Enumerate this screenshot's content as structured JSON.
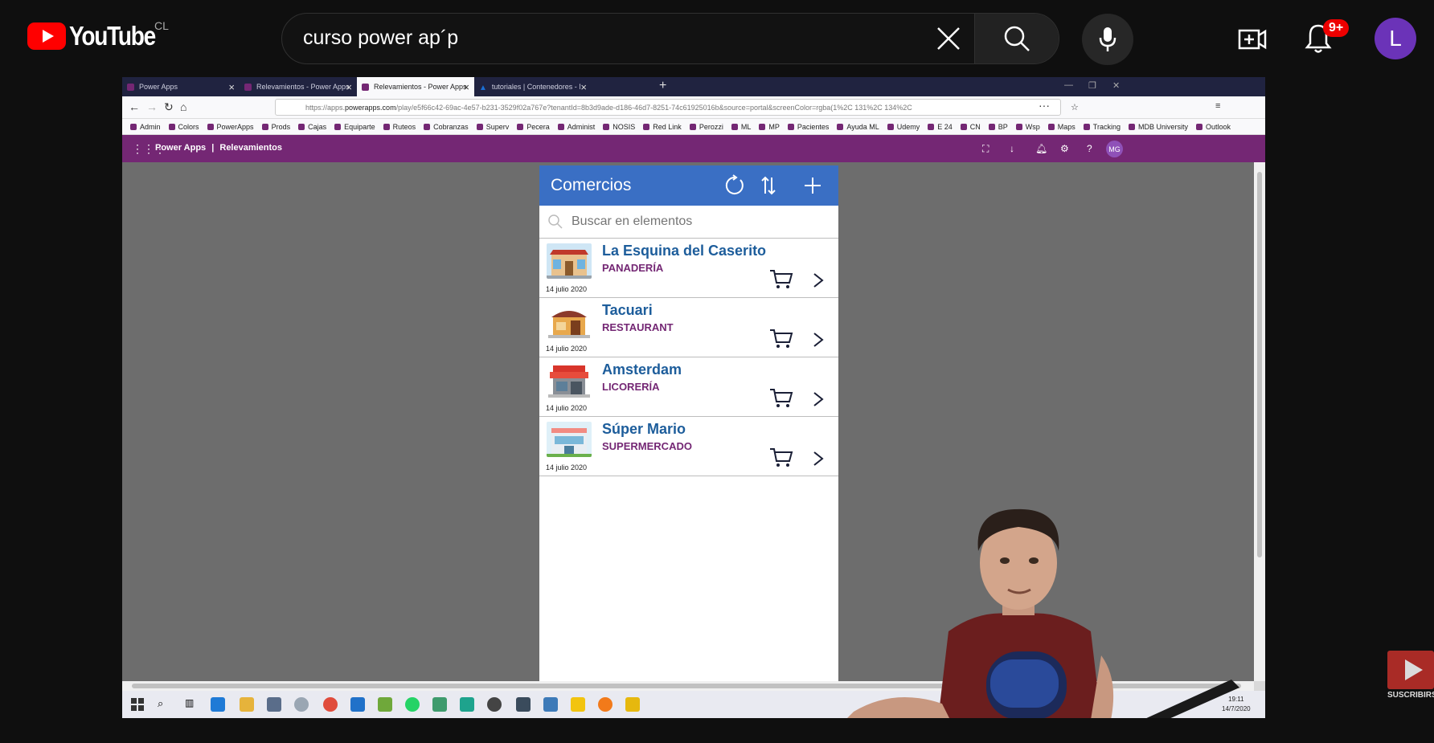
{
  "youtube": {
    "logo_text": "YouTube",
    "country": "CL",
    "search_query": "curso power ap´p",
    "notification_count": "9+",
    "avatar_letter": "L",
    "subscribe_label": "SUSCRIBIRSE"
  },
  "browser": {
    "tabs": [
      {
        "label": "Power Apps"
      },
      {
        "label": "Relevamientos - Power Apps"
      },
      {
        "label": "Relevamientos - Power Apps"
      },
      {
        "label": "tutoriales | Contenedores - Mi"
      }
    ],
    "url_prefix": "https://apps.",
    "url_domain": "powerapps.com",
    "url_rest": "/play/e5f66c42-69ac-4e57-b231-3529f02a767e?tenantId=8b3d9ade-d186-46d7-8251-74c61925016b&source=portal&screenColor=rgba(1%2C 131%2C 134%2C",
    "bookmarks": [
      "Admin",
      "Colors",
      "PowerApps",
      "Prods",
      "Cajas",
      "Equiparte",
      "Ruteos",
      "Cobranzas",
      "Superv",
      "Pecera",
      "Administ",
      "NOSIS",
      "Red Link",
      "Perozzi",
      "ML",
      "MP",
      "Pacientes",
      "Ayuda ML",
      "Udemy",
      "E 24",
      "CN",
      "BP",
      "Wsp",
      "Maps",
      "Tracking",
      "MDB University",
      "Outlook"
    ]
  },
  "powerapps": {
    "brand": "Power Apps",
    "separator": "|",
    "app_name": "Relevamientos",
    "user_initials": "MG"
  },
  "app": {
    "title": "Comercios",
    "search_placeholder": "Buscar en elementos",
    "items": [
      {
        "title": "La Esquina del Caserito",
        "category": "PANADERÍA",
        "date": "14 julio 2020"
      },
      {
        "title": "Tacuari",
        "category": "RESTAURANT",
        "date": "14 julio 2020"
      },
      {
        "title": "Amsterdam",
        "category": "LICORERÍA",
        "date": "14 julio 2020"
      },
      {
        "title": "Súper Mario",
        "category": "SUPERMERCADO",
        "date": "14 julio 2020"
      }
    ]
  },
  "taskbar": {
    "time": "19:11",
    "date": "14/7/2020"
  },
  "colors": {
    "youtube_red": "#ff0000",
    "powerapps_purple": "#742774",
    "app_header_blue": "#3a6fc4",
    "item_title_blue": "#1d5d9b"
  }
}
